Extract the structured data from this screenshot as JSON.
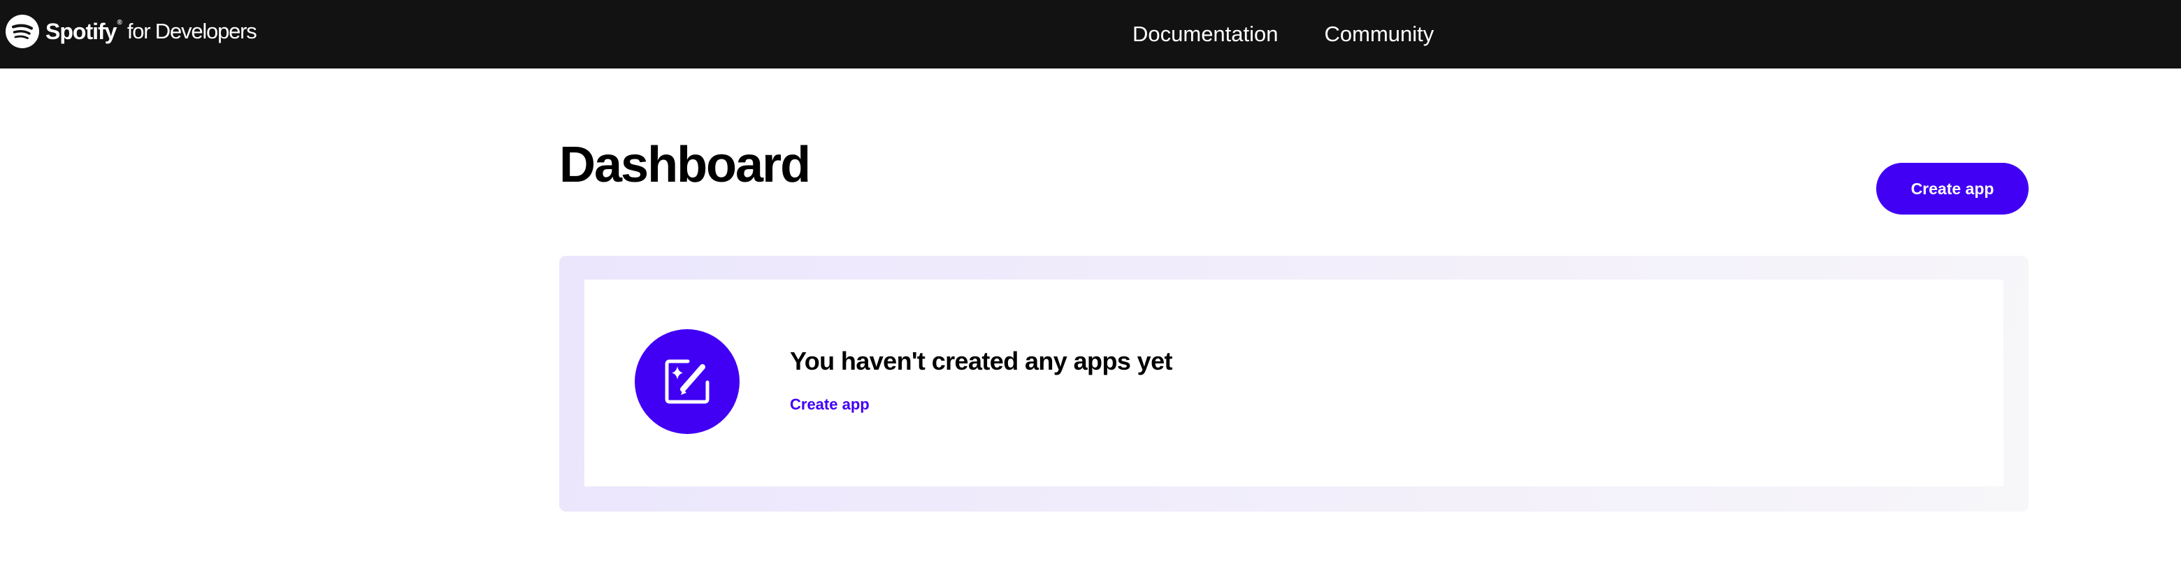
{
  "header": {
    "brand_name": "Spotify",
    "brand_registered": "®",
    "brand_sub": "for Developers",
    "nav": [
      {
        "label": "Documentation"
      },
      {
        "label": "Community"
      }
    ]
  },
  "main": {
    "title": "Dashboard",
    "create_button_label": "Create app",
    "empty_state": {
      "icon": "edit-sparkle-icon",
      "title": "You haven't created any apps yet",
      "link_label": "Create app"
    }
  },
  "colors": {
    "topbar_bg": "#121212",
    "accent": "#4100f4",
    "panel_tint": "#ebe6fc",
    "page_bg": "#ffffff"
  }
}
